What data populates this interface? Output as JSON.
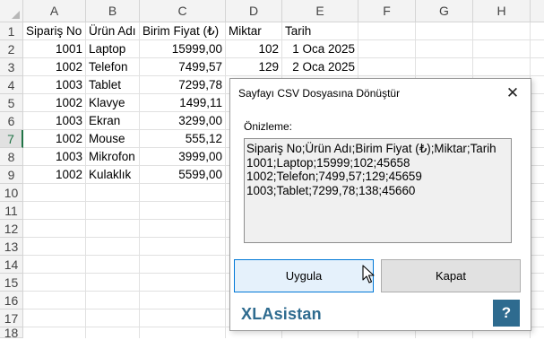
{
  "columns": [
    "A",
    "B",
    "C",
    "D",
    "E",
    "F",
    "G",
    "H"
  ],
  "rows": [
    "1",
    "2",
    "3",
    "4",
    "5",
    "6",
    "7",
    "8",
    "9",
    "10",
    "11",
    "12",
    "13",
    "14",
    "15",
    "16",
    "17",
    "18"
  ],
  "selected_row": "7",
  "cells": {
    "r1": [
      "Sipariş No",
      "Ürün Adı",
      "Birim Fiyat (₺)",
      "Miktar",
      "Tarih"
    ],
    "r2": [
      "1001",
      "Laptop",
      "15999,00",
      "102",
      "1 Oca 2025"
    ],
    "r3": [
      "1002",
      "Telefon",
      "7499,57",
      "129",
      "2 Oca 2025"
    ],
    "r4": [
      "1003",
      "Tablet",
      "7299,78"
    ],
    "r5": [
      "1002",
      "Klavye",
      "1499,11"
    ],
    "r6": [
      "1003",
      "Ekran",
      "3299,00"
    ],
    "r7": [
      "1002",
      "Mouse",
      "555,12"
    ],
    "r8": [
      "1003",
      "Mikrofon",
      "3999,00"
    ],
    "r9": [
      "1002",
      "Kulaklık",
      "5599,00"
    ]
  },
  "dialog": {
    "title": "Sayfayı CSV Dosyasına Dönüştür",
    "close_symbol": "✕",
    "preview_label": "Önizleme:",
    "preview_text": "Sipariş No;Ürün Adı;Birim Fiyat (₺);Miktar;Tarih\n1001;Laptop;15999;102;45658\n1002;Telefon;7499,57;129;45659\n1003;Tablet;7299,78;138;45660",
    "apply_label": "Uygula",
    "close_label": "Kapat",
    "brand": "XLAsistan",
    "help_label": "?"
  },
  "colors": {
    "excel_green": "#217346",
    "brand_blue": "#2e6b8f",
    "apply_border": "#0078d7"
  }
}
